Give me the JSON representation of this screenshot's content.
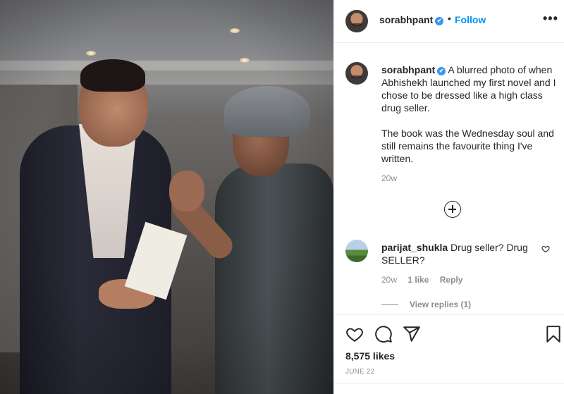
{
  "post": {
    "author": "sorabhpant",
    "verified_mark": "✔",
    "separator": "•",
    "follow_label": "Follow",
    "more_label": "•••",
    "icons": [
      "verified-badge",
      "more-options-icon",
      "add-comments-icon",
      "heart-icon",
      "comment-icon",
      "share-icon",
      "bookmark-icon"
    ]
  },
  "caption": {
    "author": "sorabhpant",
    "line1": "A blurred photo of when Abhishekh launched my first novel and I chose to be dressed like a high class drug seller.",
    "line2": "The book was the Wednesday soul and still remains the favourite thing I've written.",
    "time": "20w"
  },
  "comments": [
    {
      "author": "parijat_shukla",
      "text": "Drug seller? Drug SELLER?",
      "time": "20w",
      "likes": "1 like",
      "reply_label": "Reply",
      "view_replies": "View replies (1)"
    }
  ],
  "footer": {
    "likes": "8,575 likes",
    "date": "JUNE 22"
  }
}
